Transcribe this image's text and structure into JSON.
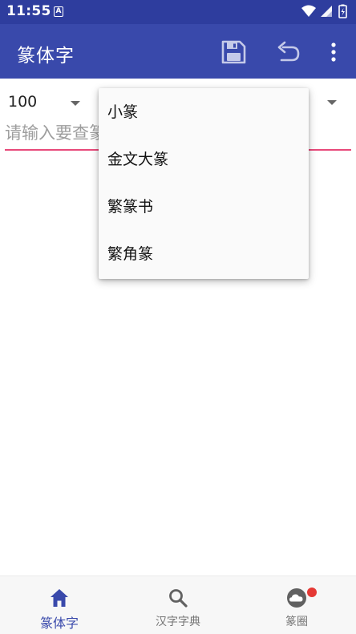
{
  "status_bar": {
    "time": "11:55",
    "notification_letter": "A"
  },
  "app_bar": {
    "title": "篆体字",
    "save_icon": "save-icon",
    "undo_icon": "undo-icon",
    "more_icon": "more-vert-icon",
    "background_color": "#3949ab"
  },
  "controls": {
    "size_value": "100",
    "search_placeholder": "请输入要查篆字的汉字",
    "underline_color": "#e84a7a"
  },
  "dropdown": {
    "items": [
      {
        "label": "小篆"
      },
      {
        "label": "金文大篆"
      },
      {
        "label": "繁篆书"
      },
      {
        "label": "繁角篆"
      }
    ]
  },
  "bottom_nav": {
    "items": [
      {
        "label": "篆体字",
        "icon": "home-icon",
        "active": true
      },
      {
        "label": "汉字字典",
        "icon": "search-icon",
        "active": false
      },
      {
        "label": "篆圈",
        "icon": "cloud-icon",
        "active": false,
        "badge": true
      }
    ],
    "active_color": "#3949ab",
    "badge_color": "#e53935"
  }
}
